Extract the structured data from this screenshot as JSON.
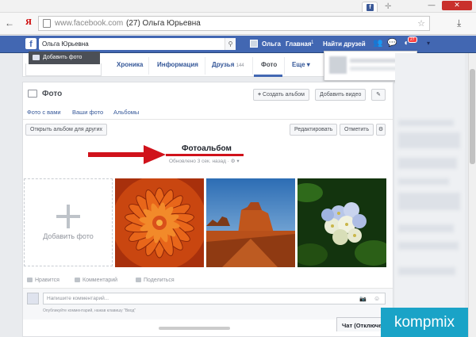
{
  "browser": {
    "url": "www.facebook.com",
    "page_title": "(27) Ольга Юрьевна",
    "back_icon": "arrow-left-icon",
    "yandex_label": "Я",
    "minimize_label": "—",
    "close_label": "✕",
    "new_tab_label": "✛",
    "star_label": "☆",
    "download_label": "⤓"
  },
  "fb_bar": {
    "logo": "f",
    "search_value": "Ольга Юрьевна",
    "search_icon": "⚲",
    "user_name": "Ольга",
    "home": "Главная",
    "home_count": "1",
    "find_friends": "Найти друзей",
    "friends_icon": "👥",
    "messages_icon": "💬",
    "notifications_badge": "27",
    "settings_label": "▾",
    "brand_color": "#4267b2"
  },
  "profile": {
    "add_photo": "Добавить фото",
    "tabs": {
      "chronicle": "Хроника",
      "info": "Информация",
      "friends": "Друзья",
      "friends_count": "144",
      "photos": "Фото",
      "more": "Еще ▾"
    }
  },
  "photos": {
    "title": "Фото",
    "create_album": "Создать альбом",
    "create_album_plus": "+",
    "add_video": "Добавить видео",
    "edit_icon": "✎",
    "subtabs": {
      "with_you": "Фото с вами",
      "your_photos": "Ваши фото",
      "albums": "Альбомы"
    },
    "open_album": "Открыть альбом для других",
    "edit": "Редактировать",
    "tag": "Отметить",
    "gear_icon": "⚙",
    "album_title": "Фотоальбом",
    "album_updated": "Обновлено 3 сек. назад · ⚙ ▾",
    "add_photo_tile": "Добавить фото",
    "actions": {
      "like": "Нравится",
      "comment": "Комментарий",
      "share": "Поделиться"
    },
    "comment_placeholder": "Напишите комментарий...",
    "comment_hint": "Опубликуйте комментарий, нажав клавишу \"Ввод\"",
    "camera_icon": "📷",
    "smile_icon": "☺"
  },
  "chat": {
    "label": "Чат (Отключен)"
  },
  "watermark": "kompmix",
  "accent": "#d0121b"
}
